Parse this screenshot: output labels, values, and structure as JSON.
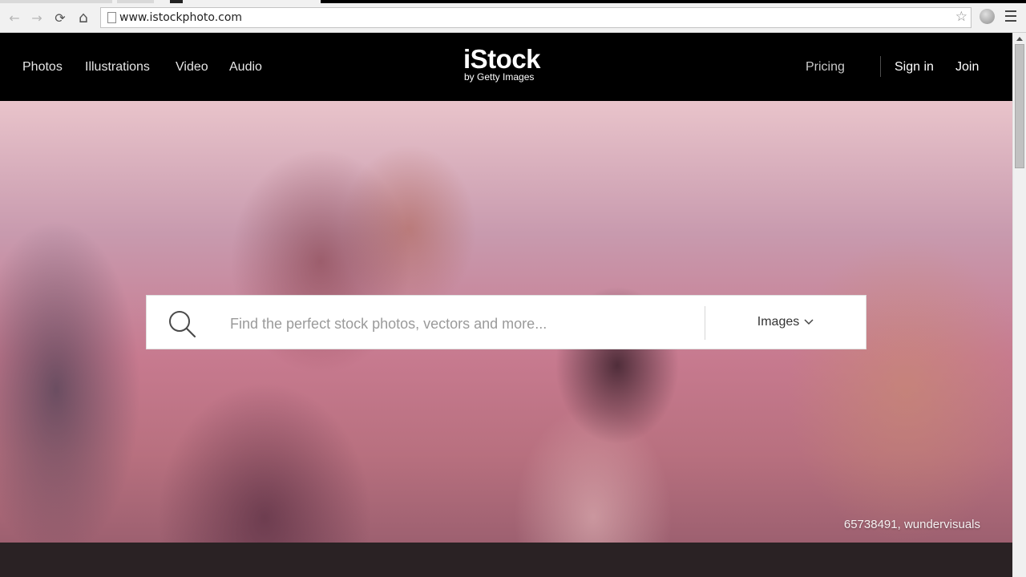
{
  "browser": {
    "back_icon": "←",
    "forward_icon": "→",
    "reload_icon": "⟳",
    "home_icon": "⌂",
    "url": "www.istockphoto.com",
    "star_icon": "☆"
  },
  "header": {
    "nav": [
      "Photos",
      "Illustrations",
      "Video",
      "Audio"
    ],
    "logo_main": "iStock",
    "logo_sub": "by Getty Images",
    "pricing": "Pricing",
    "sign_in": "Sign in",
    "join": "Join"
  },
  "hero": {
    "search_placeholder": "Find the perfect stock photos, vectors and more...",
    "search_value": "",
    "search_type": "Images",
    "credit": "65738491, wundervisuals"
  }
}
